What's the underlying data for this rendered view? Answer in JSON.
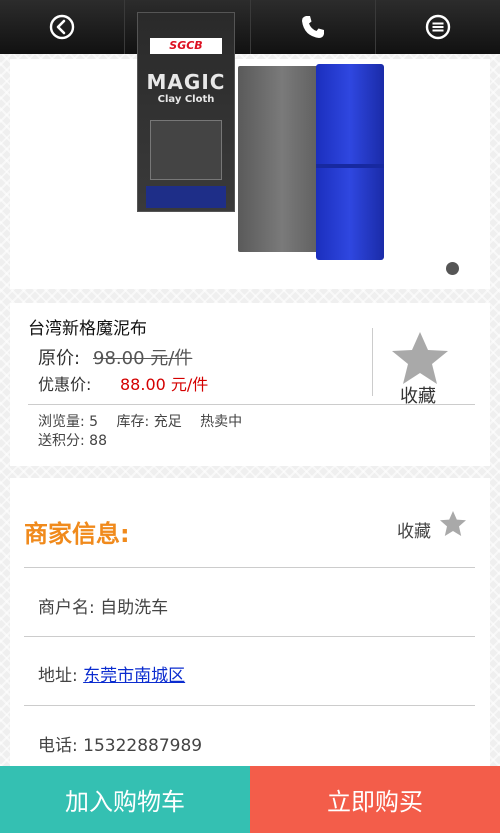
{
  "nav": {
    "icons": [
      "back-circle-icon",
      "user-icon",
      "phone-icon",
      "menu-circle-icon"
    ]
  },
  "product": {
    "package_brand": "SGCB",
    "package_title_1": "MAGIC",
    "package_title_2": "Clay Cloth",
    "name": "台湾新格魔泥布",
    "original_label": "原价:",
    "original_price": "98.00 元/件",
    "sale_label": "优惠价:",
    "sale_price": "88.00 元/件",
    "favorite_label": "收藏",
    "views": "浏览量: 5",
    "stock": "库存: 充足",
    "hot": "热卖中",
    "points": "送积分: 88"
  },
  "merchant": {
    "title": "商家信息:",
    "favorite_label": "收藏",
    "name_row": "商户名: 自助洗车",
    "address_label": "地址: ",
    "address_link": "东莞市南城区",
    "phone_row": "电话: 15322887989"
  },
  "actions": {
    "add_to_cart": "加入购物车",
    "buy_now": "立即购买"
  },
  "colors": {
    "cart_button": "#34c0b2",
    "buy_button": "#f35d4a",
    "merchant_title": "#f08a1c",
    "sale_price": "#d40000"
  }
}
